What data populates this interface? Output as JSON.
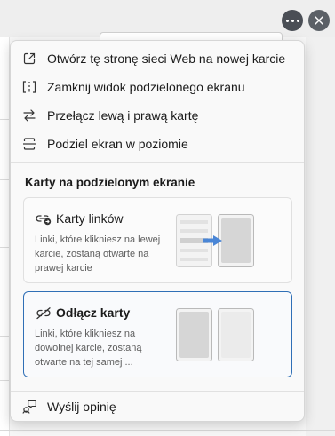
{
  "menu": {
    "items": [
      {
        "label": "Otwórz tę stronę sieci Web na nowej karcie",
        "icon": "open-in-new-tab-icon"
      },
      {
        "label": "Zamknij widok podzielonego ekranu",
        "icon": "close-split-screen-icon"
      },
      {
        "label": "Przełącz lewą i prawą kartę",
        "icon": "swap-arrows-icon"
      },
      {
        "label": "Podziel ekran w poziomie",
        "icon": "split-horizontal-icon"
      }
    ],
    "section_title": "Karty na podzielonym ekranie",
    "cards": [
      {
        "title": "Karty linków",
        "icon": "link-tabs-icon",
        "description": "Linki, które klikniesz na lewej karcie, zostaną otwarte na prawej karcie",
        "selected": false
      },
      {
        "title": "Odłącz karty",
        "icon": "unlink-tabs-icon",
        "description": "Linki, które klikniesz na dowolnej karcie, zostaną otwarte na tej samej ...",
        "selected": true
      }
    ],
    "feedback_label": "Wyślij opinię"
  },
  "colors": {
    "accent": "#2f6fb6",
    "arrow": "#4a86d6",
    "toolbar_button": "#4a4e55"
  }
}
